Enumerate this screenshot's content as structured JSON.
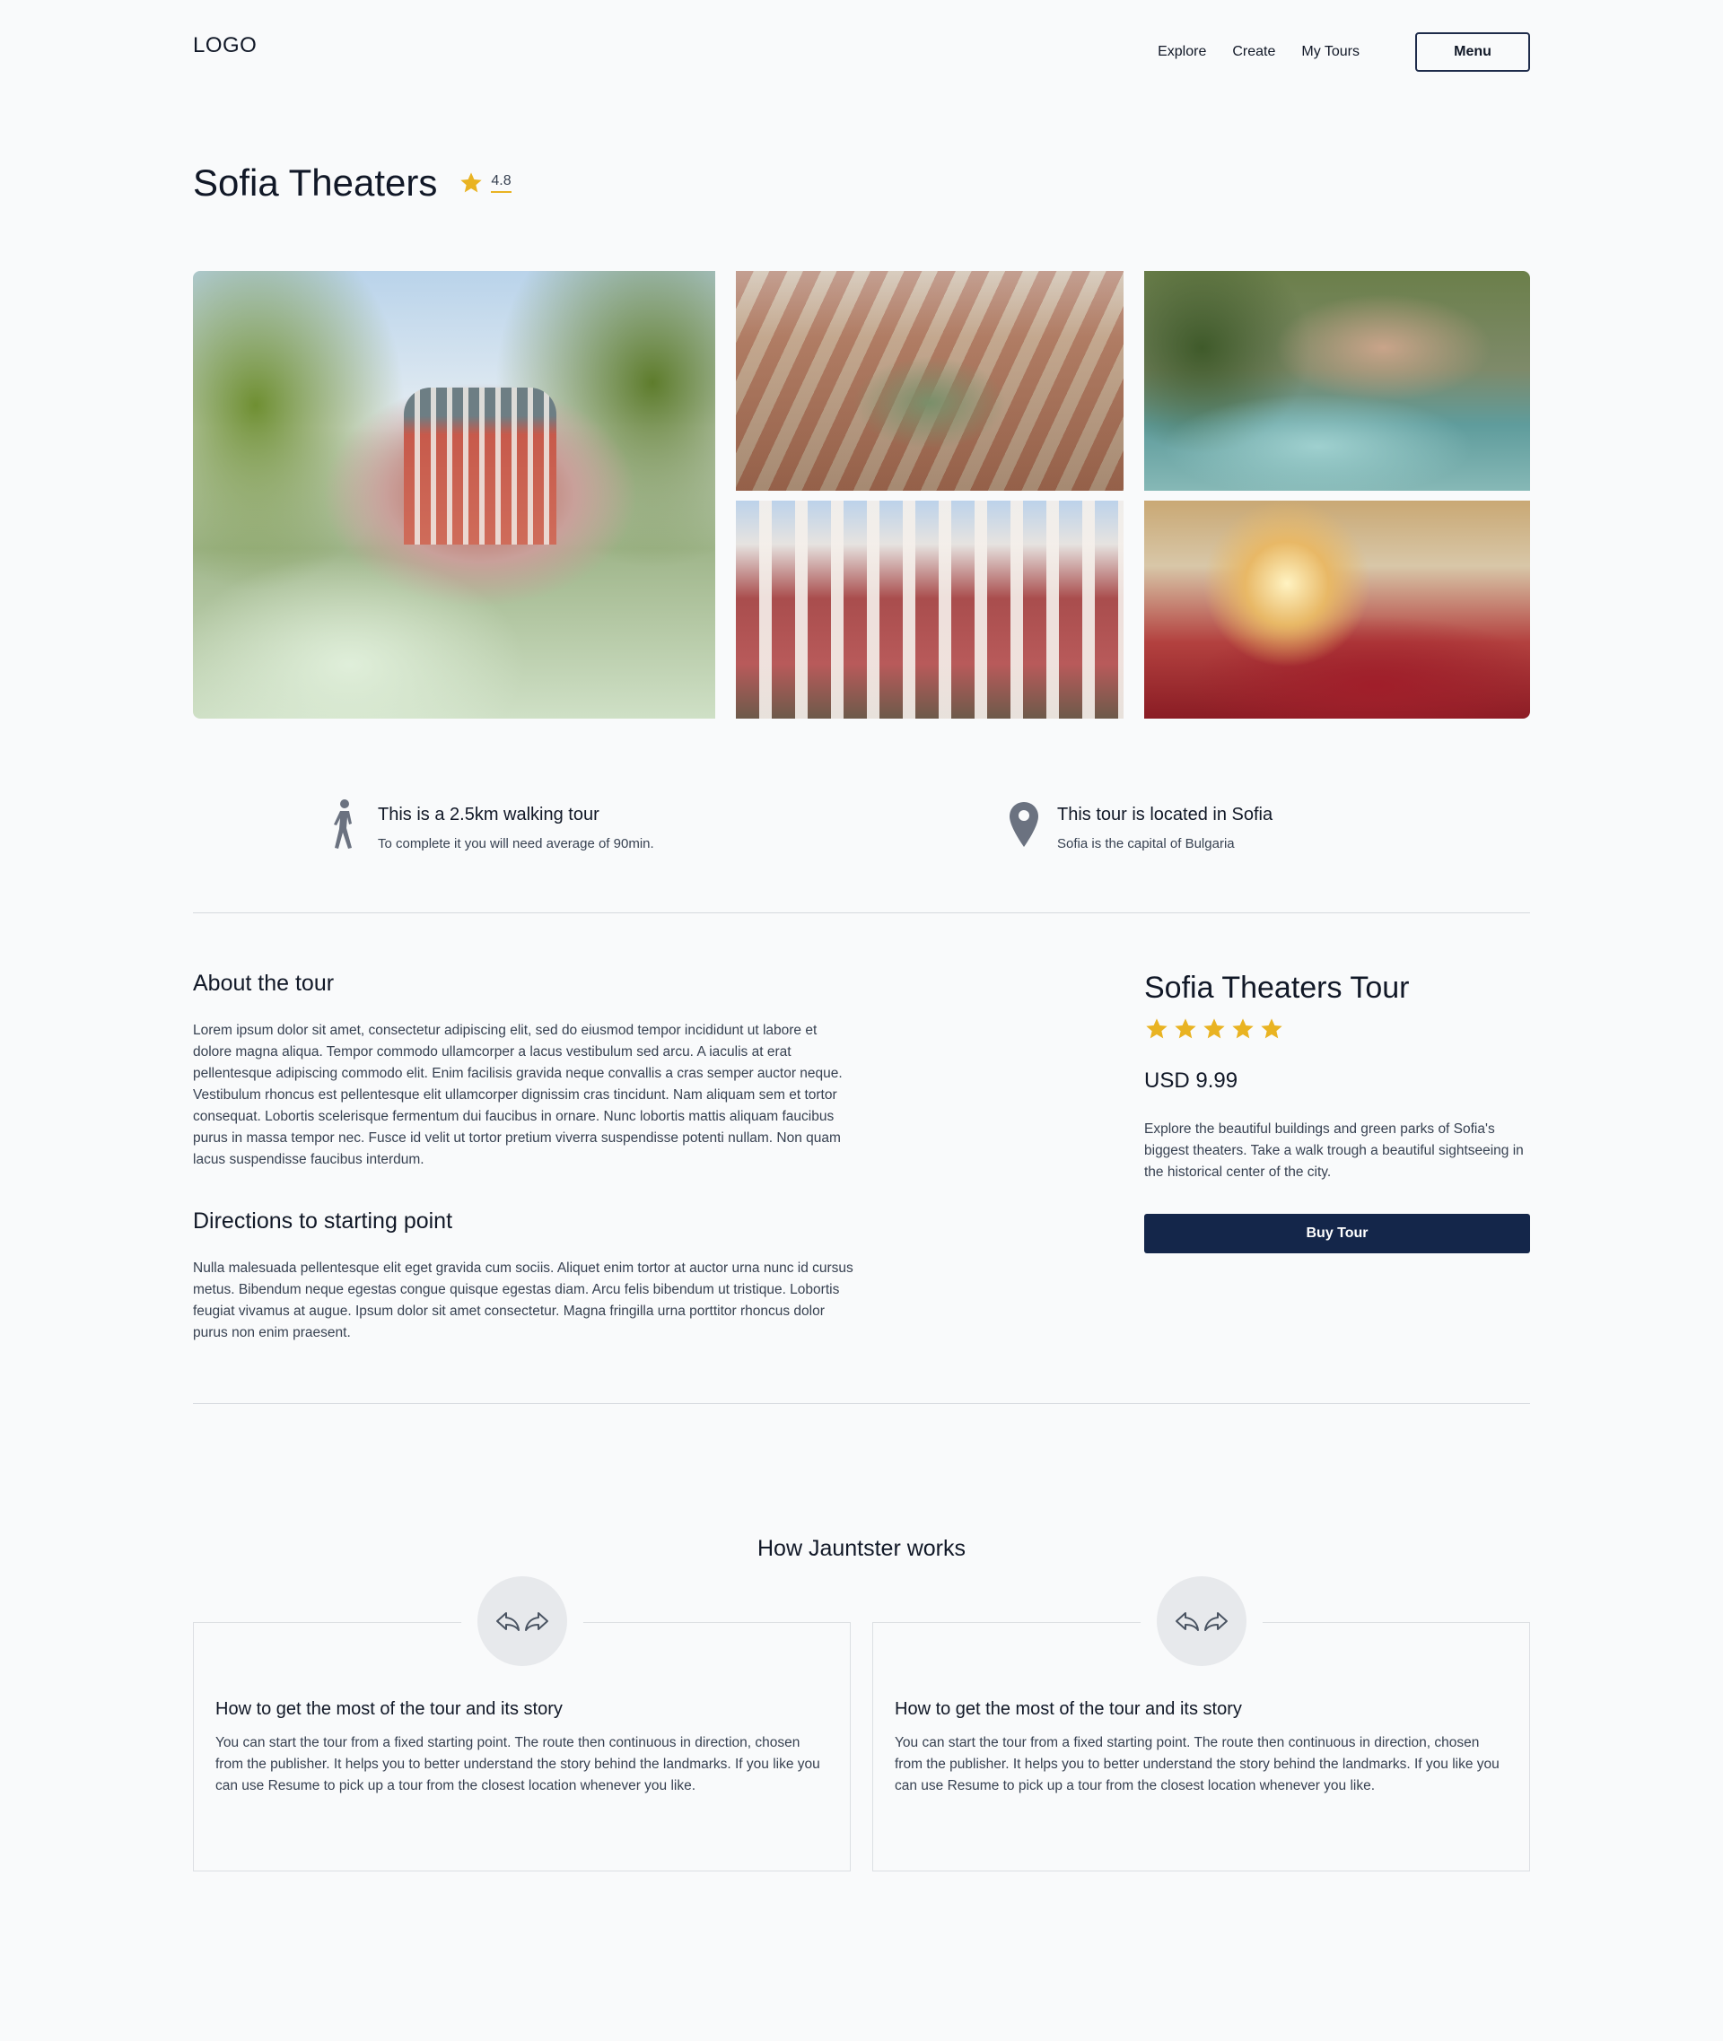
{
  "header": {
    "logo": "LOGO",
    "nav": [
      "Explore",
      "Create",
      "My Tours"
    ],
    "menu_label": "Menu"
  },
  "title": {
    "text": "Sofia Theaters",
    "rating": "4.8"
  },
  "info": {
    "walking": {
      "icon": "walking-person-icon",
      "title": "This is a 2.5km walking tour",
      "subtitle": "To complete it you will need average of 90min."
    },
    "location": {
      "icon": "location-pin-icon",
      "title": "This tour is located in Sofia",
      "subtitle": "Sofia is the capital of Bulgaria"
    }
  },
  "about": {
    "heading": "About the tour",
    "text": "Lorem ipsum dolor sit amet, consectetur adipiscing elit, sed do eiusmod tempor incididunt ut labore et dolore magna aliqua. Tempor commodo ullamcorper a lacus vestibulum sed arcu. A iaculis at erat pellentesque adipiscing commodo elit. Enim facilisis gravida neque convallis a cras semper auctor neque. Vestibulum rhoncus est pellentesque elit ullamcorper dignissim cras tincidunt. Nam aliquam sem et tortor consequat. Lobortis scelerisque fermentum dui faucibus in ornare. Nunc lobortis mattis aliquam faucibus purus in massa tempor nec. Fusce id velit ut tortor pretium viverra suspendisse potenti nullam. Non quam lacus suspendisse faucibus interdum.",
    "directions_heading": "Directions to starting point",
    "directions_text": "Nulla malesuada pellentesque elit eget gravida cum sociis. Aliquet enim tortor at auctor urna nunc id cursus metus. Bibendum neque egestas congue quisque egestas diam. Arcu felis bibendum ut tristique. Lobortis feugiat vivamus at augue. Ipsum dolor sit amet consectetur. Magna fringilla urna porttitor rhoncus dolor purus non enim praesent."
  },
  "purchase": {
    "title": "Sofia Theaters Tour",
    "stars": 5,
    "price": "USD 9.99",
    "description": "Explore the beautiful buildings and green parks of Sofia's biggest theaters. Take a walk trough a beautiful sightseeing in the historical center of the city.",
    "button": "Buy Tour"
  },
  "how": {
    "title": "How Jauntster works",
    "cards": [
      {
        "icon": "reply-forward-arrows-icon",
        "title": "How to get the most of the tour and its story",
        "text": "You can start the tour from a fixed starting point. The route then continuous in direction, chosen from the publisher. It helps you to better understand the story behind the landmarks. If you like you can use Resume to pick up a tour from the closest location whenever you like."
      },
      {
        "icon": "reply-forward-arrows-icon",
        "title": "How to get the most of the tour and its story",
        "text": "You can start the tour from a fixed starting point. The route then continuous in direction, chosen from the publisher. It helps you to better understand the story behind the landmarks. If you like you can use Resume to pick up a tour from the closest location whenever you like."
      }
    ]
  },
  "colors": {
    "accent_star": "#e9b322",
    "button_dark": "#14264a",
    "icon_gray": "#6b7280"
  }
}
